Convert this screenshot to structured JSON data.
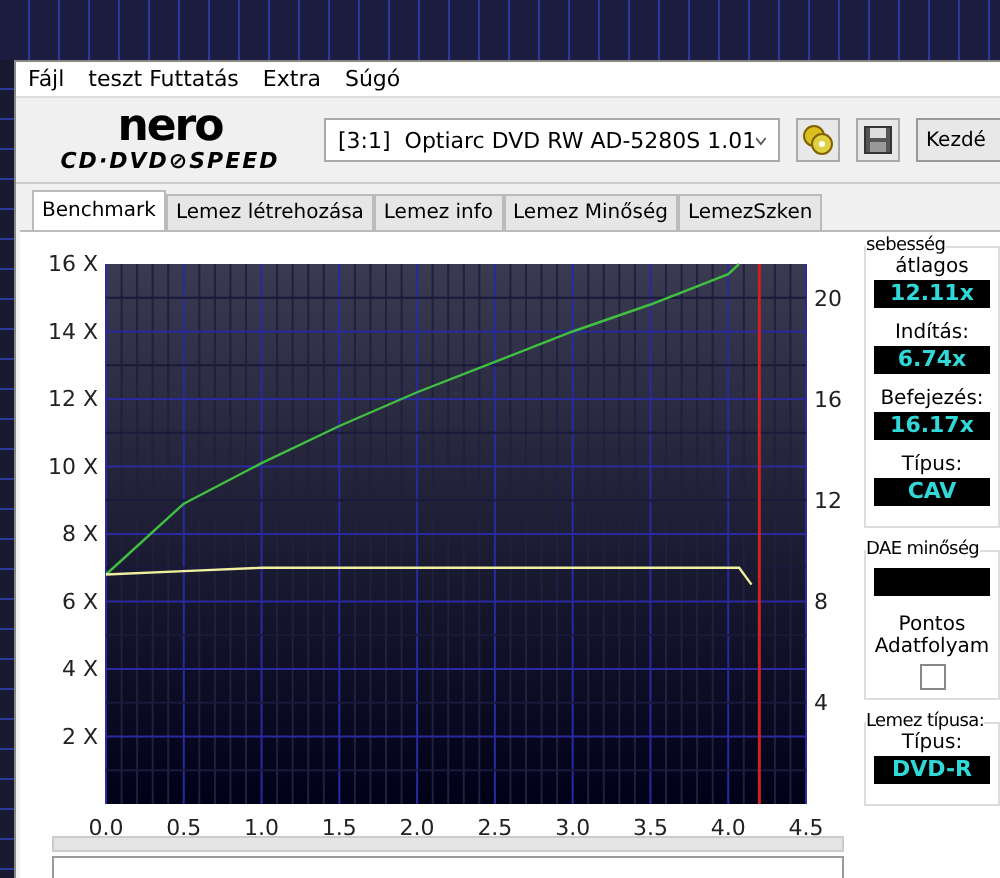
{
  "menu": [
    "Fájl",
    "teszt Futtatás",
    "Extra",
    "Súgó"
  ],
  "toolbar": {
    "logo_top": "nero",
    "logo_bottom": "CD·DVD⊘SPEED",
    "drive": "[3:1]  Optiarc DVD RW AD-5280S 1.01",
    "start_button": "Kezdé"
  },
  "tabs": [
    {
      "label": "Benchmark",
      "selected": true
    },
    {
      "label": "Lemez létrehozása",
      "selected": false
    },
    {
      "label": "Lemez info",
      "selected": false
    },
    {
      "label": "Lemez Minőség",
      "selected": false
    },
    {
      "label": "LemezSzken",
      "selected": false
    }
  ],
  "chart": {
    "chart_data": {
      "type": "line",
      "x": [
        0,
        0.5,
        1.0,
        1.5,
        2.0,
        2.5,
        3.0,
        3.5,
        4.0,
        4.07,
        4.15
      ],
      "series": [
        {
          "color": "#40c040",
          "values": [
            6.8,
            8.9,
            10.1,
            11.2,
            12.2,
            13.1,
            14.0,
            14.8,
            15.7,
            16.0,
            null
          ]
        },
        {
          "color": "#f0f0a0",
          "values": [
            6.8,
            6.9,
            7.0,
            7.0,
            7.0,
            7.0,
            7.0,
            7.0,
            7.0,
            7.0,
            6.5
          ]
        }
      ],
      "xlim": [
        0,
        4.5
      ],
      "ylim": [
        0,
        16
      ],
      "xticks": [
        {
          "value": 0,
          "label": "0.0"
        },
        {
          "value": 0.5,
          "label": "0.5"
        },
        {
          "value": 1,
          "label": "1.0"
        },
        {
          "value": 1.5,
          "label": "1.5"
        },
        {
          "value": 2,
          "label": "2.0"
        },
        {
          "value": 2.5,
          "label": "2.5"
        },
        {
          "value": 3,
          "label": "3.0"
        },
        {
          "value": 3.5,
          "label": "3.5"
        },
        {
          "value": 4,
          "label": "4.0"
        },
        {
          "value": 4.5,
          "label": "4.5"
        }
      ],
      "yticks": [
        {
          "value": 2,
          "label": "2 X"
        },
        {
          "value": 4,
          "label": "4 X"
        },
        {
          "value": 6,
          "label": "6 X"
        },
        {
          "value": 8,
          "label": "8 X"
        },
        {
          "value": 10,
          "label": "10 X"
        },
        {
          "value": 12,
          "label": "12 X"
        },
        {
          "value": 14,
          "label": "14 X"
        },
        {
          "value": 16,
          "label": "16 X"
        }
      ],
      "grid": true,
      "ref_lines": [
        {
          "axis": "x",
          "value": 4.2,
          "color": "#d02020"
        }
      ]
    },
    "right_axis_labels": [
      "20",
      "16",
      "12",
      "8",
      "4"
    ]
  },
  "progress": {
    "level": 0
  },
  "speed_group": {
    "title": "sebesség",
    "readouts": [
      {
        "label": "átlagos",
        "value": "12.11x"
      },
      {
        "label": "Indítás:",
        "value": "6.74x"
      },
      {
        "label": "Befejezés:",
        "value": "16.17x"
      },
      {
        "label": "Típus:",
        "value": "CAV"
      }
    ]
  },
  "dae_group": {
    "title": "DAE minőség",
    "option_label": "Pontos Adatfolyam",
    "checked": false
  },
  "disc_group": {
    "title": "Lemez típusa:",
    "label": "Típus:",
    "value": "DVD-R"
  }
}
